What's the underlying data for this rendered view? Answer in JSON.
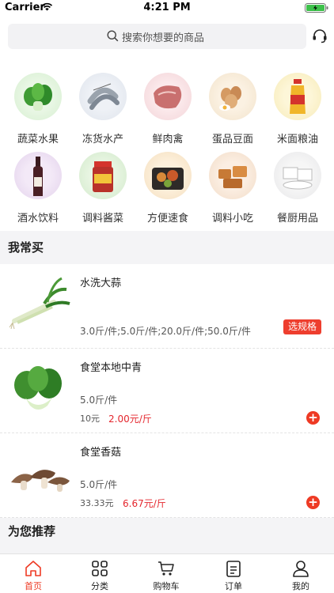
{
  "status_bar": {
    "carrier": "Carrier",
    "time": "4:21 PM"
  },
  "search": {
    "placeholder": "搜索你想要的商品"
  },
  "categories": [
    {
      "label": "蔬菜水果",
      "icon": "vegetable-icon"
    },
    {
      "label": "冻货水产",
      "icon": "shrimp-icon"
    },
    {
      "label": "鲜肉禽",
      "icon": "meat-icon"
    },
    {
      "label": "蛋品豆面",
      "icon": "egg-icon"
    },
    {
      "label": "米面粮油",
      "icon": "oil-icon"
    },
    {
      "label": "酒水饮料",
      "icon": "wine-icon"
    },
    {
      "label": "调料酱菜",
      "icon": "sauce-jar-icon"
    },
    {
      "label": "方便速食",
      "icon": "instant-food-icon"
    },
    {
      "label": "调料小吃",
      "icon": "snack-icon"
    },
    {
      "label": "餐厨用品",
      "icon": "tableware-icon"
    }
  ],
  "sections": {
    "frequent": "我常买",
    "recommend": "为您推荐"
  },
  "products": [
    {
      "name": "水洗大蒜",
      "spec": "3.0斤/件;5.0斤/件;20.0斤/件;50.0斤/件",
      "button": "选规格"
    },
    {
      "name": "食堂本地中青",
      "spec": "5.0斤/件",
      "orig_price": "10元",
      "price": "2.00元/斤",
      "add": "+"
    },
    {
      "name": "食堂香菇",
      "spec": "5.0斤/件",
      "orig_price": "33.33元",
      "price": "6.67元/斤",
      "add": "+"
    }
  ],
  "tabbar": [
    {
      "label": "首页",
      "icon": "home-icon",
      "active": true
    },
    {
      "label": "分类",
      "icon": "grid-icon",
      "active": false
    },
    {
      "label": "购物车",
      "icon": "cart-icon",
      "active": false
    },
    {
      "label": "订单",
      "icon": "order-icon",
      "active": false
    },
    {
      "label": "我的",
      "icon": "user-icon",
      "active": false
    }
  ],
  "colors": {
    "accent": "#ee3a24",
    "price": "#e4262d",
    "background": "#f4f4f6"
  }
}
